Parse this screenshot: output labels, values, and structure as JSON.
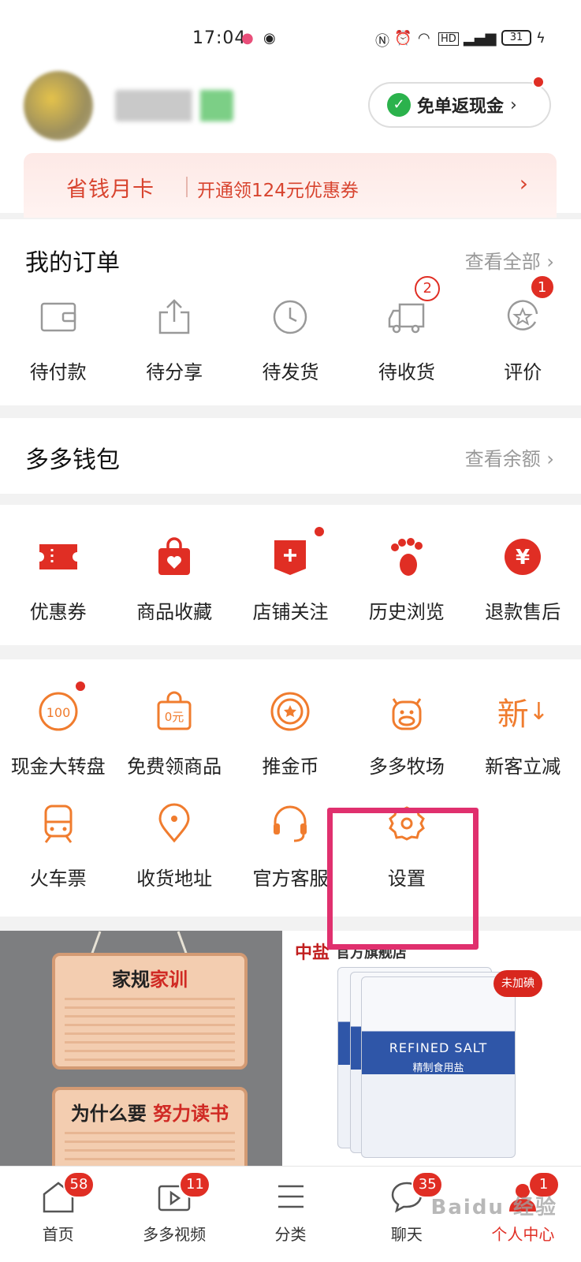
{
  "status_bar": {
    "time": "17:04",
    "battery": "31"
  },
  "header": {
    "cashback_button": "免单返现金",
    "month_card": {
      "title": "省钱月卡",
      "desc": "开通领124元优惠券"
    }
  },
  "orders": {
    "title": "我的订单",
    "view_all": "查看全部",
    "items": [
      {
        "label": "待付款",
        "icon": "wallet-icon"
      },
      {
        "label": "待分享",
        "icon": "share-icon"
      },
      {
        "label": "待发货",
        "icon": "clock-icon"
      },
      {
        "label": "待收货",
        "icon": "truck-icon",
        "badge": "2"
      },
      {
        "label": "评价",
        "icon": "review-icon",
        "badge": "1"
      }
    ]
  },
  "wallet": {
    "title": "多多钱包",
    "link": "查看余额"
  },
  "quick": {
    "items": [
      {
        "label": "优惠券",
        "icon": "coupon-icon"
      },
      {
        "label": "商品收藏",
        "icon": "favorite-bag-icon"
      },
      {
        "label": "店铺关注",
        "icon": "store-follow-icon"
      },
      {
        "label": "历史浏览",
        "icon": "footprint-icon"
      },
      {
        "label": "退款售后",
        "icon": "refund-icon"
      }
    ]
  },
  "services": {
    "row1": [
      {
        "label": "现金大转盘",
        "icon": "cash-wheel-icon"
      },
      {
        "label": "免费领商品",
        "icon": "free-goods-icon"
      },
      {
        "label": "推金币",
        "icon": "coin-push-icon"
      },
      {
        "label": "多多牧场",
        "icon": "cow-icon"
      },
      {
        "label": "新客立减",
        "icon": "new-customer-icon"
      }
    ],
    "row2": [
      {
        "label": "火车票",
        "icon": "train-icon"
      },
      {
        "label": "收货地址",
        "icon": "location-icon"
      },
      {
        "label": "官方客服",
        "icon": "headset-icon"
      },
      {
        "label": "设置",
        "icon": "settings-icon"
      }
    ],
    "new_icon_text": "新"
  },
  "products": {
    "left": {
      "heading1_a": "家规",
      "heading1_b": "家训",
      "heading2_a": "为什么要",
      "heading2_b": "努力读书"
    },
    "right": {
      "brand": "中盐",
      "store": "官方旗舰店",
      "product_en": "REFINED SALT",
      "product_cn": "精制食用盐",
      "tag": "未加碘"
    }
  },
  "tabbar": {
    "tabs": [
      {
        "label": "首页",
        "icon": "home-icon",
        "badge": "58"
      },
      {
        "label": "多多视频",
        "icon": "video-icon",
        "badge": "11"
      },
      {
        "label": "分类",
        "icon": "category-icon"
      },
      {
        "label": "聊天",
        "icon": "chat-icon",
        "badge": "35"
      },
      {
        "label": "个人中心",
        "icon": "profile-icon",
        "badge": "1"
      }
    ]
  },
  "watermark": "Baidu 经验",
  "colors": {
    "accent": "#e02e24",
    "highlight": "#e0306e",
    "orange": "#f07c2e"
  }
}
